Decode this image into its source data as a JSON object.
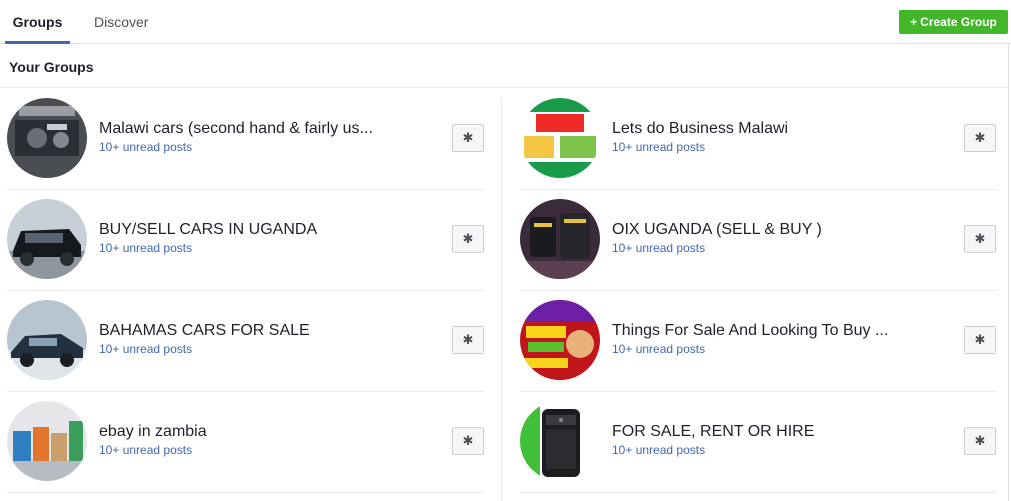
{
  "tabs": {
    "groups": "Groups",
    "discover": "Discover"
  },
  "create_button": {
    "plus": "+",
    "label": "Create Group"
  },
  "section_title": "Your Groups",
  "gear_glyph": "✱",
  "left_groups": [
    {
      "name": "Malawi cars (second hand & fairly us...",
      "unread": "10+ unread posts",
      "avatar": "engine-photo"
    },
    {
      "name": "BUY/SELL CARS IN UGANDA",
      "unread": "10+ unread posts",
      "avatar": "black-suv-photo"
    },
    {
      "name": "BAHAMAS CARS FOR SALE",
      "unread": "10+ unread posts",
      "avatar": "dark-sedan-photo"
    },
    {
      "name": "ebay in zambia",
      "unread": "10+ unread posts",
      "avatar": "shopping-bags-photo"
    }
  ],
  "right_groups": [
    {
      "name": "Lets do Business Malawi",
      "unread": "10+ unread posts",
      "avatar": "dfp-flyer-photo"
    },
    {
      "name": "OIX UGANDA (SELL & BUY )",
      "unread": "10+ unread posts",
      "avatar": "phones-photo"
    },
    {
      "name": "Things For Sale And Looking To Buy ...",
      "unread": "10+ unread posts",
      "avatar": "scratch-win-photo"
    },
    {
      "name": "FOR SALE, RENT OR HIRE",
      "unread": "10+ unread posts",
      "avatar": "blackberry-photo"
    }
  ],
  "colors": {
    "accent": "#4267b2",
    "create": "#42b72a",
    "divider": "#e9ebee"
  }
}
